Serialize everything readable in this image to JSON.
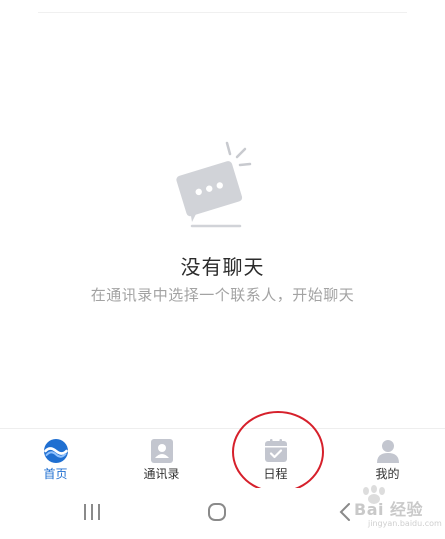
{
  "empty_state": {
    "illustration_icon": "chat-bubble-icon",
    "title": "没有聊天",
    "subtitle": "在通讯录中选择一个联系人，开始聊天"
  },
  "tabs": [
    {
      "label": "首页",
      "icon": "home-icon",
      "active": true
    },
    {
      "label": "通讯录",
      "icon": "contacts-icon",
      "active": false
    },
    {
      "label": "日程",
      "icon": "calendar-icon",
      "active": false
    },
    {
      "label": "我的",
      "icon": "profile-icon",
      "active": false
    }
  ],
  "system_nav": {
    "recents_icon": "recents-icon",
    "home_icon": "home-circle-icon",
    "back_icon": "back-icon"
  },
  "watermark": {
    "text": "Bai 经验",
    "subtext": "jingyan.baidu.com"
  },
  "colors": {
    "accent": "#1f6fd1",
    "annotation_circle": "#d6202b",
    "icon_gray": "#c3c6cf"
  }
}
